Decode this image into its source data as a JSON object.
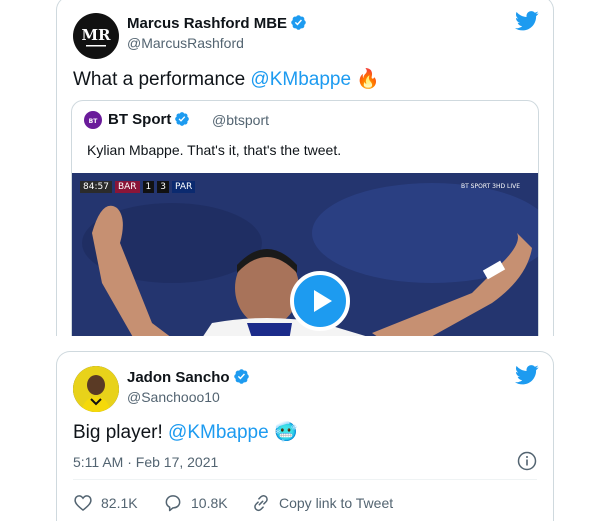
{
  "tweet1": {
    "name": "Marcus Rashford MBE",
    "handle": "@MarcusRashford",
    "text_prefix": "What a performance ",
    "mention": "@KMbappe",
    "emoji": "🔥",
    "quote": {
      "name": "BT Sport",
      "handle": "@btsport",
      "text": "Kylian Mbappe. That's it, that's the tweet.",
      "video": {
        "clock": "84:57",
        "home": "BAR",
        "home_score": "1",
        "away_score": "3",
        "away": "PAR",
        "channel": "BT SPORT 3HD LIVE"
      }
    }
  },
  "tweet2": {
    "name": "Jadon Sancho",
    "handle": "@Sanchooo10",
    "text_prefix": "Big player! ",
    "mention": "@KMbappe",
    "emoji": "🥶",
    "timestamp": "5:11 AM · Feb 17, 2021",
    "likes": "82.1K",
    "replies": "10.8K",
    "copy_link": "Copy link to Tweet"
  },
  "colors": {
    "accent": "#1d9bf0",
    "text": "#0f1419",
    "muted": "#536471",
    "border": "#cfd9de"
  }
}
